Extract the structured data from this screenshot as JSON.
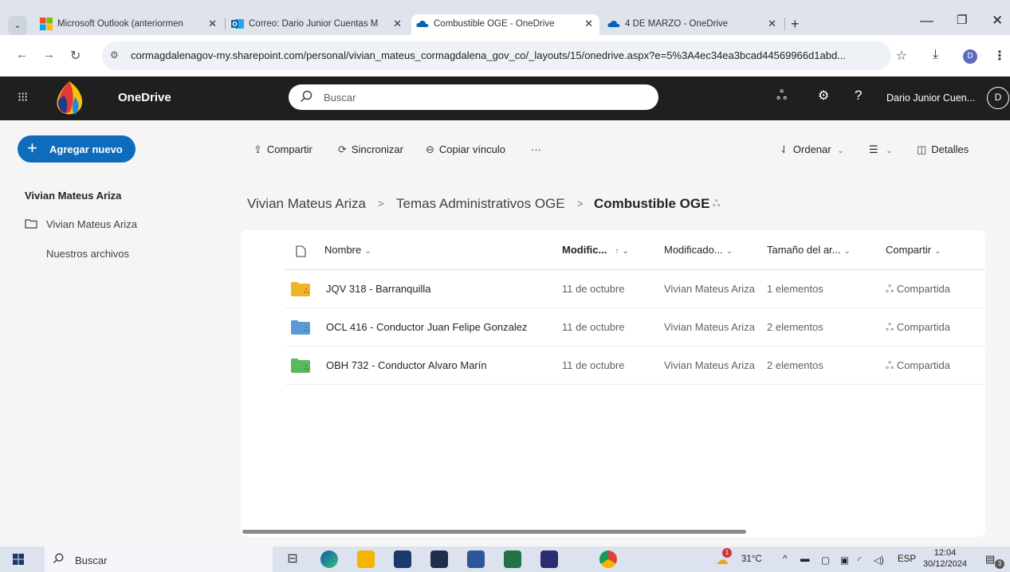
{
  "browser": {
    "tabs": [
      {
        "label": "Microsoft Outlook (anteriormen"
      },
      {
        "label": "Correo: Dario Junior Cuentas M"
      },
      {
        "label": "Combustible OGE - OneDrive",
        "active": true
      },
      {
        "label": "4 DE MARZO - OneDrive"
      }
    ],
    "url": "cormagdalenagov-my.sharepoint.com/personal/vivian_mateus_cormagdalena_gov_co/_layouts/15/onedrive.aspx?e=5%3A4ec34ea3bcad44569966d1abd...",
    "profile_initial": "D"
  },
  "header": {
    "app_name": "OneDrive",
    "search_placeholder": "Buscar",
    "user_name": "Dario Junior Cuen...",
    "avatar_initial": "D"
  },
  "nav": {
    "add_new_label": "Agregar nuevo",
    "heading": "Vivian Mateus Ariza",
    "items": [
      "Vivian Mateus Ariza",
      "Nuestros archivos"
    ]
  },
  "commands": {
    "share": "Compartir",
    "sync": "Sincronizar",
    "copy_link": "Copiar vínculo",
    "more": "···",
    "sort": "Ordenar",
    "details": "Detalles"
  },
  "breadcrumb": [
    "Vivian Mateus Ariza",
    "Temas Administrativos OGE",
    "Combustible OGE"
  ],
  "columns": {
    "name": "Nombre",
    "modified": "Modific...",
    "modified_by": "Modificado...",
    "size": "Tamaño del ar...",
    "sharing": "Compartir"
  },
  "files": [
    {
      "name": "JQV 318 - Barranquilla",
      "modified": "11 de octubre",
      "modified_by": "Vivian Mateus Ariza",
      "size": "1 elementos",
      "sharing": "Compartida",
      "folder_color": "#f0b429"
    },
    {
      "name": "OCL 416 - Conductor Juan Felipe Gonzalez",
      "modified": "11 de octubre",
      "modified_by": "Vivian Mateus Ariza",
      "size": "2 elementos",
      "sharing": "Compartida",
      "folder_color": "#5b9bd5"
    },
    {
      "name": "OBH 732 - Conductor Alvaro Marín",
      "modified": "11 de octubre",
      "modified_by": "Vivian Mateus Ariza",
      "size": "2 elementos",
      "sharing": "Compartida",
      "folder_color": "#5cb85c"
    }
  ],
  "taskbar": {
    "search_label": "Buscar",
    "weather": "31°C",
    "weather_badge": "1",
    "language": "ESP",
    "time": "12:04",
    "date": "30/12/2024",
    "notifications": "3"
  }
}
